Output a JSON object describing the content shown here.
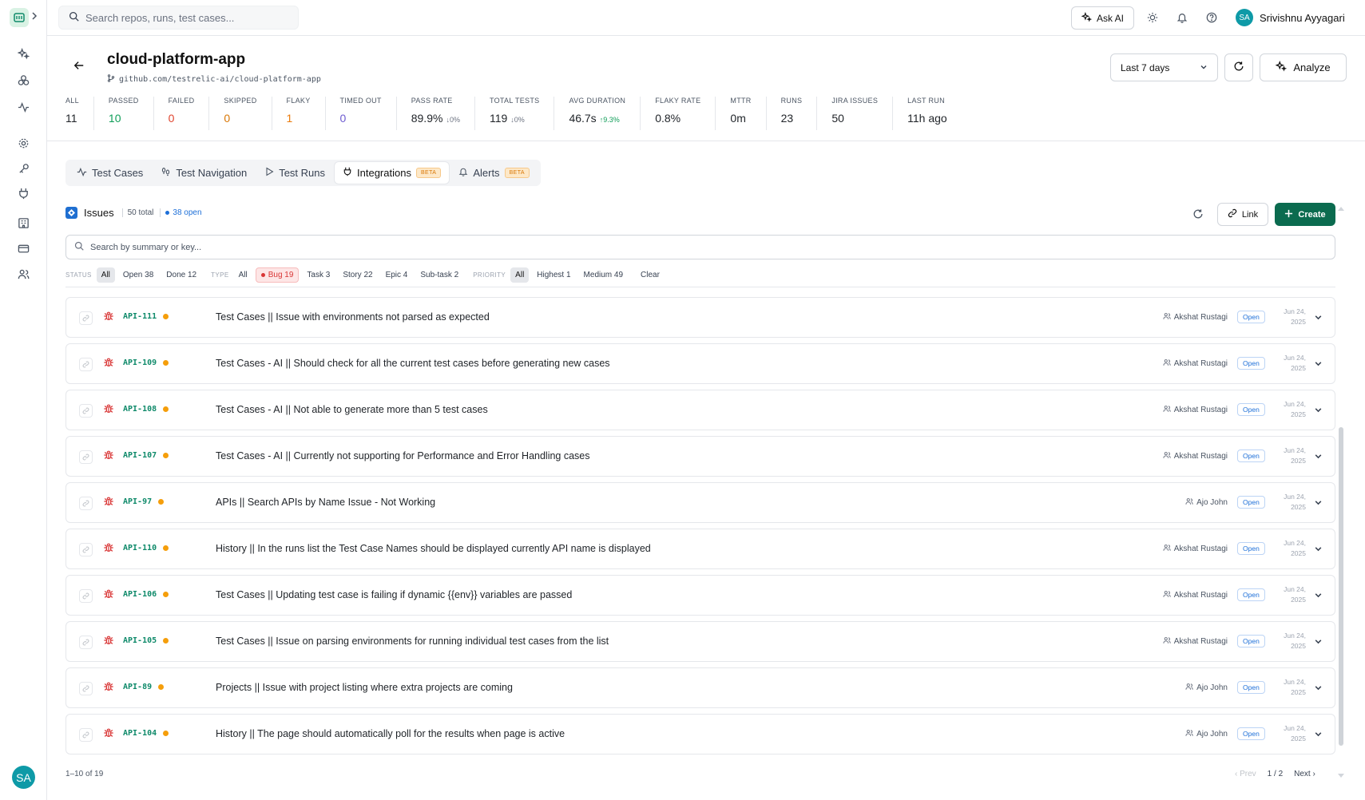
{
  "app": {
    "search_placeholder": "Search repos, runs, test cases...",
    "ask_ai_label": "Ask AI",
    "user_name": "Srivishnu Ayyagari",
    "user_initials": "SA"
  },
  "project": {
    "name": "cloud-platform-app",
    "repo": "github.com/testrelic-ai/cloud-platform-app",
    "date_range": "Last 7 days",
    "analyze_label": "Analyze"
  },
  "stats": [
    {
      "label": "ALL",
      "value": "11",
      "color": "#1f2328",
      "delta": ""
    },
    {
      "label": "PASSED",
      "value": "10",
      "color": "#0f9d58",
      "delta": ""
    },
    {
      "label": "FAILED",
      "value": "0",
      "color": "#e0452f",
      "delta": ""
    },
    {
      "label": "SKIPPED",
      "value": "0",
      "color": "#d97706",
      "delta": ""
    },
    {
      "label": "FLAKY",
      "value": "1",
      "color": "#ea7b0c",
      "delta": ""
    },
    {
      "label": "TIMED OUT",
      "value": "0",
      "color": "#6d5bd0",
      "delta": ""
    },
    {
      "label": "PASS RATE",
      "value": "89.9%",
      "color": "#1f2328",
      "delta": "↓0%"
    },
    {
      "label": "TOTAL TESTS",
      "value": "119",
      "color": "#1f2328",
      "delta": "↓0%"
    },
    {
      "label": "AVG DURATION",
      "value": "46.7s",
      "color": "#1f2328",
      "delta": "↑9.3%"
    },
    {
      "label": "FLAKY RATE",
      "value": "0.8%",
      "color": "#1f2328",
      "delta": ""
    },
    {
      "label": "MTTR",
      "value": "0m",
      "color": "#1f2328",
      "delta": ""
    },
    {
      "label": "RUNS",
      "value": "23",
      "color": "#1f2328",
      "delta": ""
    },
    {
      "label": "JIRA ISSUES",
      "value": "50",
      "color": "#1f2328",
      "delta": ""
    },
    {
      "label": "LAST RUN",
      "value": "11h ago",
      "color": "#1f2328",
      "delta": ""
    }
  ],
  "tabs": [
    {
      "label": "Test Cases",
      "icon": "activity-icon",
      "active": false,
      "beta": false
    },
    {
      "label": "Test Navigation",
      "icon": "footprints-icon",
      "active": false,
      "beta": false
    },
    {
      "label": "Test Runs",
      "icon": "play-icon",
      "active": false,
      "beta": false
    },
    {
      "label": "Integrations",
      "icon": "plug-icon",
      "active": true,
      "beta": true
    },
    {
      "label": "Alerts",
      "icon": "bell-icon",
      "active": false,
      "beta": true
    }
  ],
  "beta_label": "BETA",
  "issues": {
    "title": "Issues",
    "total": "50 total",
    "open": "38 open",
    "link_label": "Link",
    "create_label": "Create",
    "search_placeholder": "Search by summary or key...",
    "filters": {
      "status_label": "STATUS",
      "status": [
        "All",
        "Open 38",
        "Done 12"
      ],
      "type_label": "TYPE",
      "type": [
        "All",
        "Bug 19",
        "Task 3",
        "Story 22",
        "Epic 4",
        "Sub-task 2"
      ],
      "priority_label": "PRIORITY",
      "priority": [
        "All",
        "Highest 1",
        "Medium 49"
      ],
      "clear": "Clear"
    },
    "rows": [
      {
        "key": "API-111",
        "summary": "Test Cases || Issue with environments not parsed as expected",
        "assignee": "Akshat Rustagi",
        "status": "Open",
        "date_line1": "Jun 24,",
        "date_line2": "2025"
      },
      {
        "key": "API-109",
        "summary": "Test Cases - AI || Should check for all the current test cases before generating new cases",
        "assignee": "Akshat Rustagi",
        "status": "Open",
        "date_line1": "Jun 24,",
        "date_line2": "2025"
      },
      {
        "key": "API-108",
        "summary": "Test Cases - AI || Not able to generate more than 5 test cases",
        "assignee": "Akshat Rustagi",
        "status": "Open",
        "date_line1": "Jun 24,",
        "date_line2": "2025"
      },
      {
        "key": "API-107",
        "summary": "Test Cases - AI || Currently not supporting for Performance and Error Handling cases",
        "assignee": "Akshat Rustagi",
        "status": "Open",
        "date_line1": "Jun 24,",
        "date_line2": "2025"
      },
      {
        "key": "API-97",
        "summary": "APIs || Search APIs by Name Issue - Not Working",
        "assignee": "Ajo John",
        "status": "Open",
        "date_line1": "Jun 24,",
        "date_line2": "2025"
      },
      {
        "key": "API-110",
        "summary": "History || In the runs list the Test Case Names should be displayed currently API name is displayed",
        "assignee": "Akshat Rustagi",
        "status": "Open",
        "date_line1": "Jun 24,",
        "date_line2": "2025"
      },
      {
        "key": "API-106",
        "summary": "Test Cases || Updating test case is failing if dynamic {{env}} variables are passed",
        "assignee": "Akshat Rustagi",
        "status": "Open",
        "date_line1": "Jun 24,",
        "date_line2": "2025"
      },
      {
        "key": "API-105",
        "summary": "Test Cases || Issue on parsing environments for running individual test cases from the list",
        "assignee": "Akshat Rustagi",
        "status": "Open",
        "date_line1": "Jun 24,",
        "date_line2": "2025"
      },
      {
        "key": "API-89",
        "summary": "Projects || Issue with project listing where extra projects are coming",
        "assignee": "Ajo John",
        "status": "Open",
        "date_line1": "Jun 24,",
        "date_line2": "2025"
      },
      {
        "key": "API-104",
        "summary": "History || The page should automatically poll for the results when page is active",
        "assignee": "Ajo John",
        "status": "Open",
        "date_line1": "Jun 24,",
        "date_line2": "2025"
      }
    ],
    "range": "1–10 of 19",
    "pager": {
      "prev": "‹ Prev",
      "page": "1 / 2",
      "next": "Next ›"
    }
  }
}
